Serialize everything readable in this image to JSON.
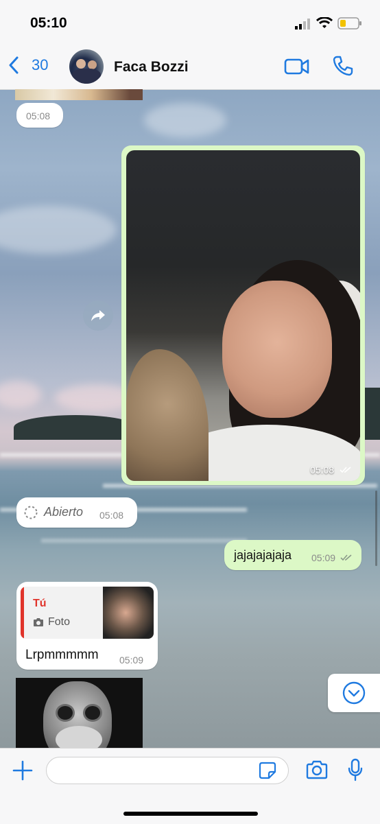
{
  "status": {
    "time": "05:10"
  },
  "header": {
    "back_count": "30",
    "contact_name": "Faca Bozzi"
  },
  "messages": {
    "m1": {
      "time": "05:08"
    },
    "photo": {
      "time": "05:08"
    },
    "viewonce": {
      "label": "Abierto",
      "time": "05:08"
    },
    "out_text": {
      "text": "jajajajajaja",
      "time": "05:09"
    },
    "reply": {
      "quoted_author": "Tú",
      "quoted_type": "Foto",
      "text": "Lrpmmmmm",
      "time": "05:09"
    }
  },
  "icons": {
    "back": "chevron-left-icon",
    "video": "video-camera-icon",
    "call": "phone-icon",
    "forward": "forward-icon",
    "plus": "plus-icon",
    "sticker": "sticker-icon",
    "camera": "camera-icon",
    "mic": "microphone-icon",
    "scroll": "chevron-down-icon"
  },
  "colors": {
    "accent": "#1f7ae0",
    "outgoing": "#dcf8c6",
    "reply_bar": "#e0342b"
  }
}
